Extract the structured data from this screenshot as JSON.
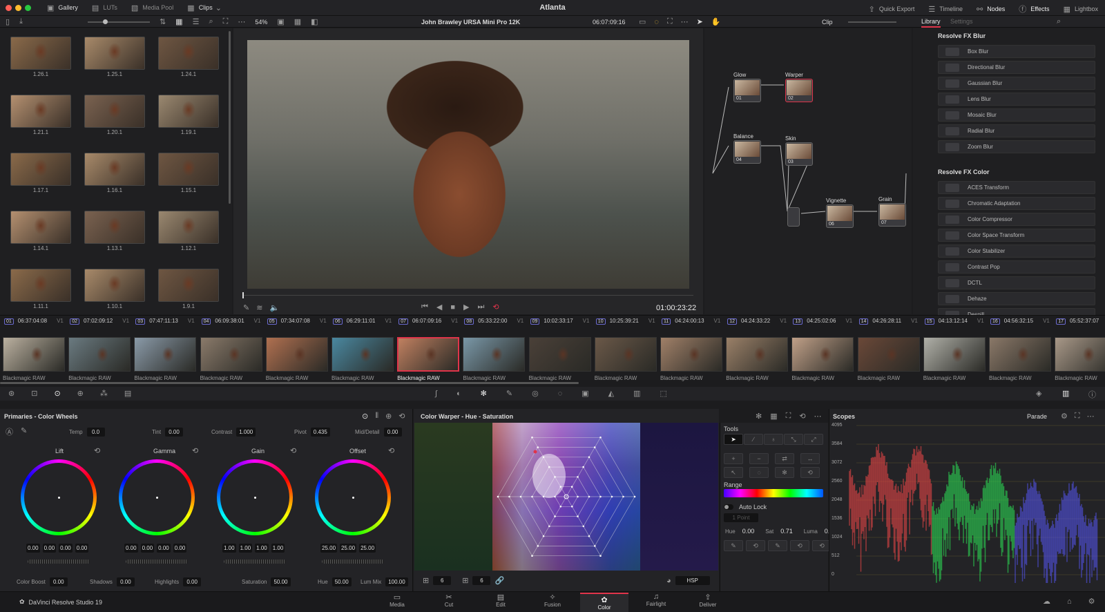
{
  "title": "Atlanta",
  "topbar": {
    "left": [
      "Gallery",
      "LUTs",
      "Media Pool",
      "Clips"
    ],
    "right": [
      "Quick Export",
      "Timeline",
      "Nodes",
      "Effects",
      "Lightbox"
    ]
  },
  "toolbar": {
    "zoom": "54%",
    "clip_name": "John Brawley URSA Mini Pro 12K",
    "timecode": "06:07:09:16",
    "node_mode": "Clip",
    "tabs": [
      "Library",
      "Settings"
    ]
  },
  "gallery": [
    "1.26.1",
    "1.25.1",
    "1.24.1",
    "1.21.1",
    "1.20.1",
    "1.19.1",
    "1.17.1",
    "1.16.1",
    "1.15.1",
    "1.14.1",
    "1.13.1",
    "1.12.1",
    "1.11.1",
    "1.10.1",
    "1.9.1"
  ],
  "viewer": {
    "timecode": "01:00:23:22"
  },
  "nodes": [
    {
      "label": "Glow",
      "num": "01"
    },
    {
      "label": "Warper",
      "num": "02"
    },
    {
      "label": "Balance",
      "num": "04"
    },
    {
      "label": "Skin",
      "num": "03"
    },
    {
      "label": "Vignette",
      "num": "06"
    },
    {
      "label": "Grain",
      "num": "07"
    }
  ],
  "library": {
    "blur_title": "Resolve FX Blur",
    "blur": [
      "Box Blur",
      "Directional Blur",
      "Gaussian Blur",
      "Lens Blur",
      "Mosaic Blur",
      "Radial Blur",
      "Zoom Blur"
    ],
    "color_title": "Resolve FX Color",
    "color": [
      "ACES Transform",
      "Chromatic Adaptation",
      "Color Compressor",
      "Color Space Transform",
      "Color Stabilizer",
      "Contrast Pop",
      "DCTL",
      "Dehaze",
      "Despill"
    ]
  },
  "clips": [
    {
      "num": "01",
      "tc": "06:37:04:08"
    },
    {
      "num": "02",
      "tc": "07:02:09:12"
    },
    {
      "num": "03",
      "tc": "07:47:11:13"
    },
    {
      "num": "04",
      "tc": "06:09:38:01"
    },
    {
      "num": "05",
      "tc": "07:34:07:08"
    },
    {
      "num": "06",
      "tc": "06:29:11:01"
    },
    {
      "num": "07",
      "tc": "06:07:09:16"
    },
    {
      "num": "08",
      "tc": "05:33:22:00"
    },
    {
      "num": "09",
      "tc": "10:02:33:17"
    },
    {
      "num": "10",
      "tc": "10:25:39:21"
    },
    {
      "num": "11",
      "tc": "04:24:00:13"
    },
    {
      "num": "12",
      "tc": "04:24:33:22"
    },
    {
      "num": "13",
      "tc": "04:25:02:06"
    },
    {
      "num": "14",
      "tc": "04:26:28:11"
    },
    {
      "num": "15",
      "tc": "04:13:12:14"
    },
    {
      "num": "16",
      "tc": "04:56:32:15"
    },
    {
      "num": "17",
      "tc": "05:52:37:07"
    }
  ],
  "track": "V1",
  "codec": "Blackmagic RAW",
  "primaries": {
    "title": "Primaries - Color Wheels",
    "params": [
      {
        "label": "Temp",
        "value": "0.0"
      },
      {
        "label": "Tint",
        "value": "0.00"
      },
      {
        "label": "Contrast",
        "value": "1.000"
      },
      {
        "label": "Pivot",
        "value": "0.435"
      },
      {
        "label": "Mid/Detail",
        "value": "0.00"
      }
    ],
    "wheels": [
      {
        "label": "Lift",
        "values": [
          "0.00",
          "0.00",
          "0.00",
          "0.00"
        ]
      },
      {
        "label": "Gamma",
        "values": [
          "0.00",
          "0.00",
          "0.00",
          "0.00"
        ]
      },
      {
        "label": "Gain",
        "values": [
          "1.00",
          "1.00",
          "1.00",
          "1.00"
        ]
      },
      {
        "label": "Offset",
        "values": [
          "25.00",
          "25.00",
          "25.00"
        ]
      }
    ],
    "bottom": [
      {
        "label": "Color Boost",
        "value": "0.00"
      },
      {
        "label": "Shadows",
        "value": "0.00"
      },
      {
        "label": "Highlights",
        "value": "0.00"
      },
      {
        "label": "Saturation",
        "value": "50.00"
      },
      {
        "label": "Hue",
        "value": "50.00"
      },
      {
        "label": "Lum Mix",
        "value": "100.00"
      }
    ]
  },
  "warper": {
    "title": "Color Warper - Hue - Saturation",
    "grid1": "6",
    "grid2": "6",
    "mode": "HSP"
  },
  "tools": {
    "title": "Tools",
    "range": "Range",
    "autolock": "Auto Lock",
    "point": "1 Point",
    "hue_label": "Hue",
    "hue": "0.00",
    "sat_label": "Sat",
    "sat": "0.71",
    "luma_label": "Luma",
    "luma": "0.50"
  },
  "scopes": {
    "title": "Scopes",
    "mode": "Parade",
    "ticks": [
      "4095",
      "3584",
      "3072",
      "2560",
      "2048",
      "1536",
      "1024",
      "512",
      "0"
    ]
  },
  "pages": [
    "Media",
    "Cut",
    "Edit",
    "Fusion",
    "Color",
    "Fairlight",
    "Deliver"
  ],
  "brand": "DaVinci Resolve Studio 19",
  "colors": {
    "accent": "#e0344a",
    "background": "#1c1c1e"
  }
}
